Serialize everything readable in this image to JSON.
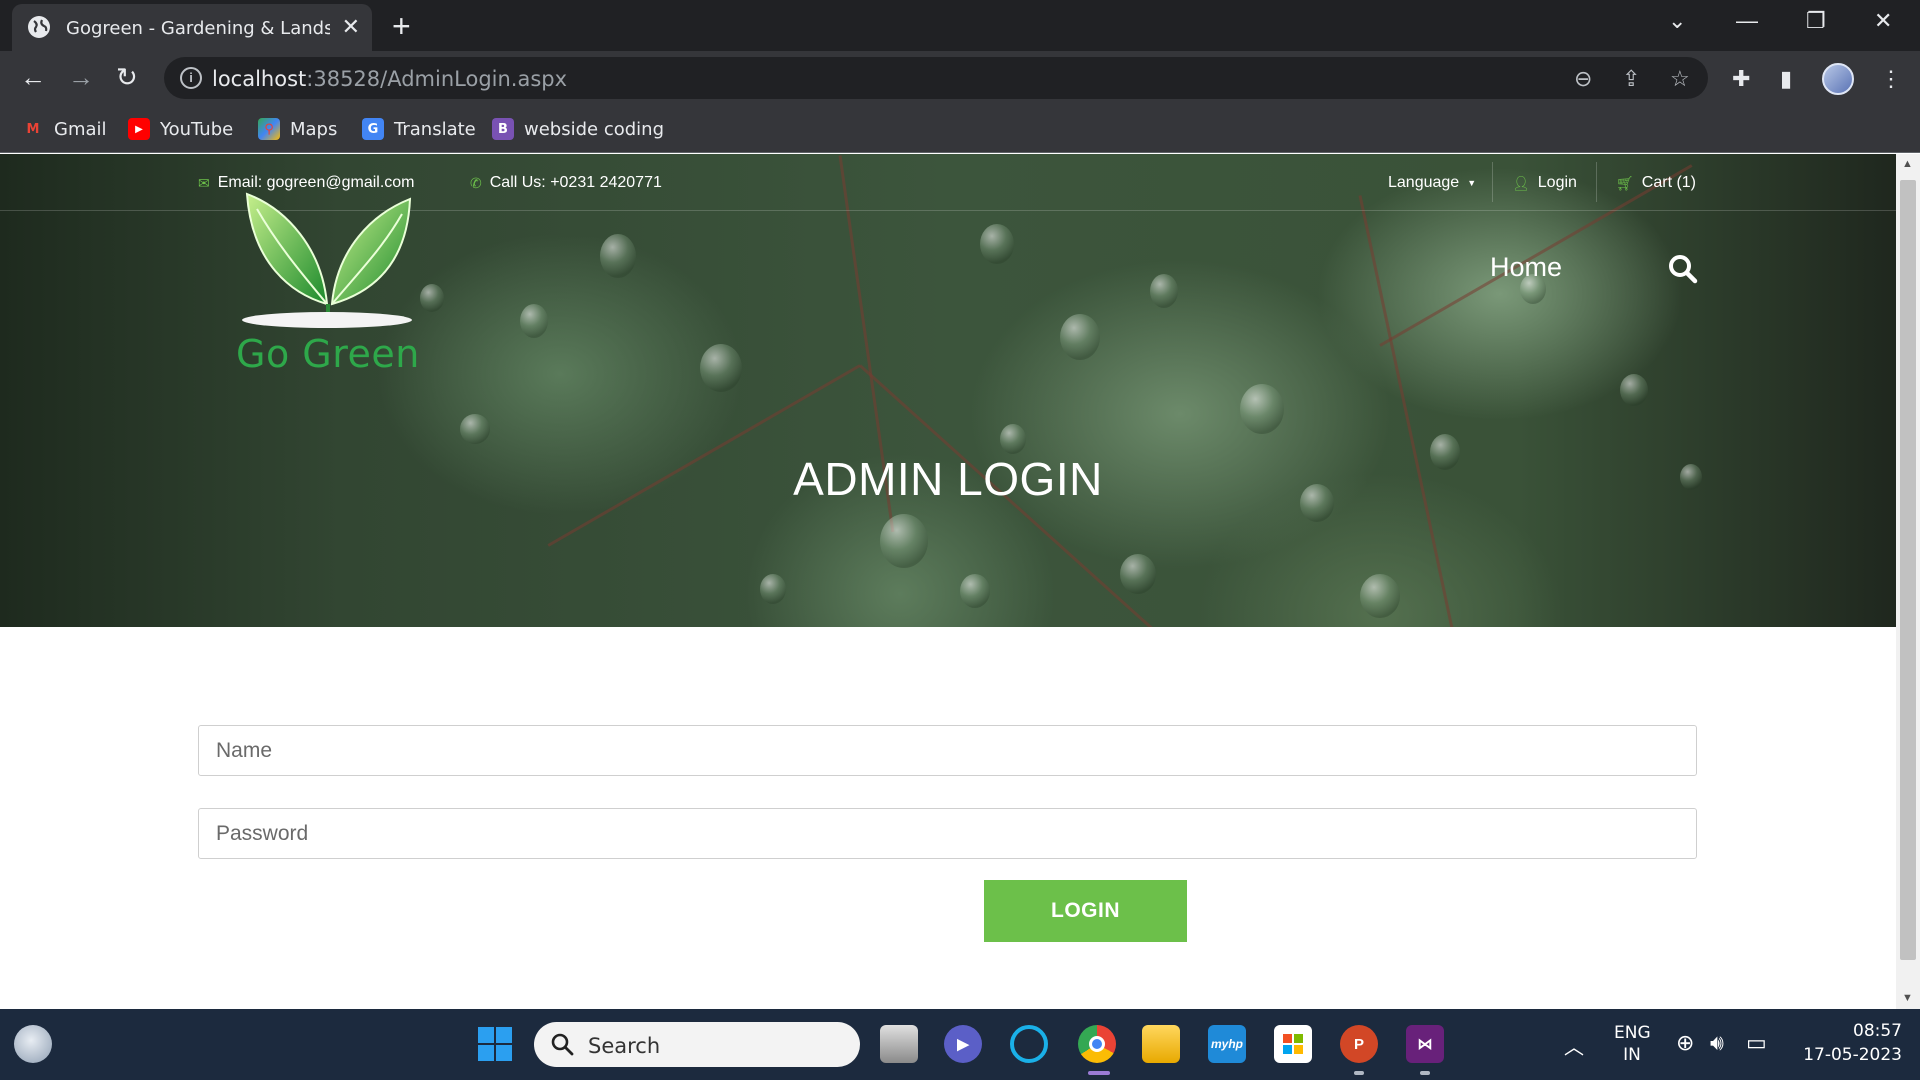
{
  "browser": {
    "tab_title": "Gogreen - Gardening & Landscaping",
    "url_host": "localhost",
    "url_path": ":38528/AdminLogin.aspx",
    "bookmarks": [
      {
        "label": "Gmail",
        "icon": "gmail-icon"
      },
      {
        "label": "YouTube",
        "icon": "youtube-icon"
      },
      {
        "label": "Maps",
        "icon": "maps-icon"
      },
      {
        "label": "Translate",
        "icon": "translate-icon"
      },
      {
        "label": "webside coding",
        "icon": "bootstrap-icon"
      }
    ]
  },
  "site": {
    "email": "Email: gogreen@gmail.com",
    "phone": "Call Us: +0231 2420771",
    "language": "Language",
    "login": "Login",
    "cart": "Cart (1)",
    "logo_text": "Go Green",
    "nav_home": "Home",
    "page_title": "ADMIN LOGIN",
    "accent_color": "#6cc04a"
  },
  "form": {
    "name_placeholder": "Name",
    "password_placeholder": "Password",
    "login_button": "LOGIN"
  },
  "taskbar": {
    "search_label": "Search",
    "lang_line1": "ENG",
    "lang_line2": "IN",
    "time": "08:57",
    "date": "17-05-2023"
  }
}
